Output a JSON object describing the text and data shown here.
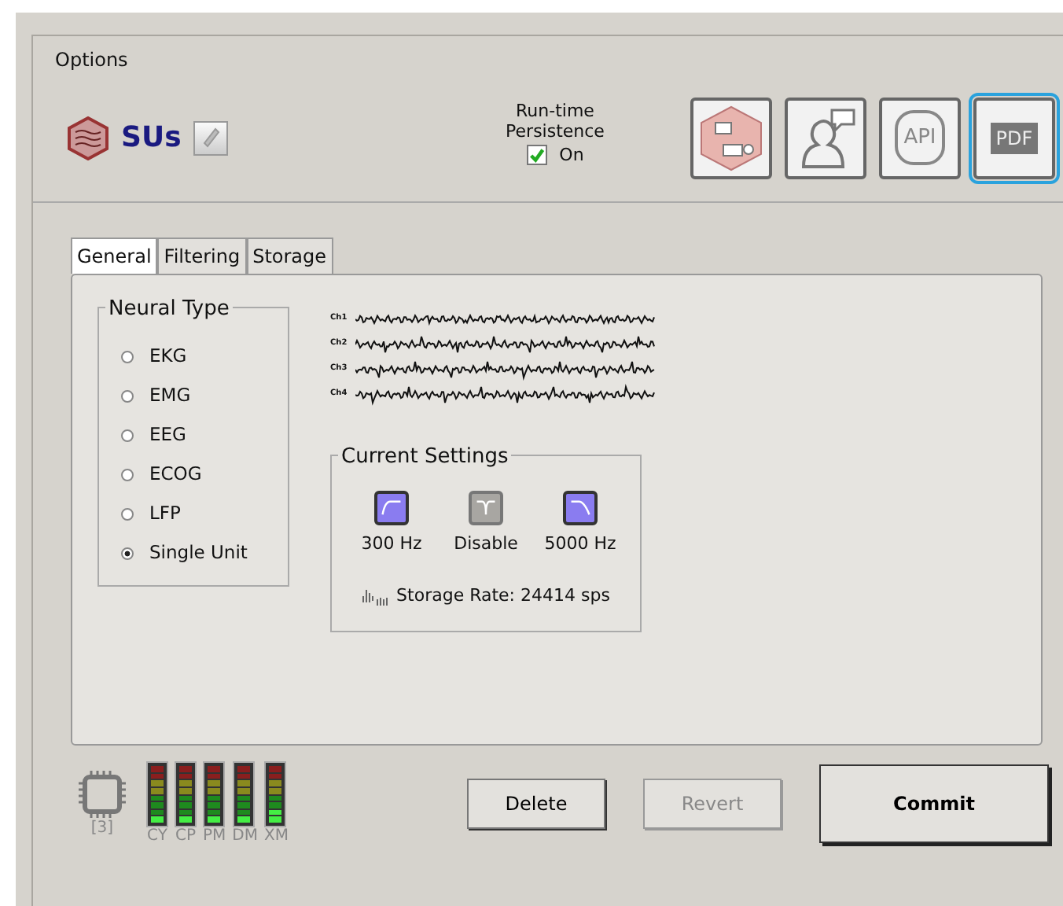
{
  "group_title": "Options",
  "header": {
    "name": "SUs",
    "persistence_label": "Run-time Persistence",
    "persistence": {
      "label": "On",
      "checked": true
    }
  },
  "tools": [
    {
      "kind": "diagram",
      "selected": false
    },
    {
      "kind": "user",
      "selected": false
    },
    {
      "kind": "api",
      "label": "API",
      "selected": false
    },
    {
      "kind": "pdf",
      "label": "PDF",
      "selected": true
    }
  ],
  "tabs": [
    {
      "label": "General",
      "selected": true
    },
    {
      "label": "Filtering",
      "selected": false
    },
    {
      "label": "Storage",
      "selected": false
    }
  ],
  "neural_type": {
    "title": "Neural Type",
    "options": [
      {
        "label": "EKG",
        "selected": false
      },
      {
        "label": "EMG",
        "selected": false
      },
      {
        "label": "EEG",
        "selected": false
      },
      {
        "label": "ECOG",
        "selected": false
      },
      {
        "label": "LFP",
        "selected": false
      },
      {
        "label": "Single Unit",
        "selected": true
      }
    ]
  },
  "channels": [
    {
      "label": "Ch1"
    },
    {
      "label": "Ch2"
    },
    {
      "label": "Ch3"
    },
    {
      "label": "Ch4"
    }
  ],
  "current_settings": {
    "title": "Current Settings",
    "filters": [
      {
        "kind": "highpass",
        "enabled": true,
        "label": "300 Hz"
      },
      {
        "kind": "notch",
        "enabled": false,
        "label": "Disable"
      },
      {
        "kind": "lowpass",
        "enabled": true,
        "label": "5000 Hz"
      }
    ],
    "storage_rate": "Storage Rate: 24414 sps"
  },
  "cpu": {
    "label": "[3]"
  },
  "meters": [
    {
      "label": "CY",
      "level": 0.1
    },
    {
      "label": "CP",
      "level": 0.1
    },
    {
      "label": "PM",
      "level": 0.1
    },
    {
      "label": "DM",
      "level": 0.1
    },
    {
      "label": "XM",
      "level": 0.3
    }
  ],
  "buttons": [
    {
      "label": "Delete",
      "disabled": false,
      "primary": false
    },
    {
      "label": "Revert",
      "disabled": true,
      "primary": false
    },
    {
      "label": "Commit",
      "disabled": false,
      "primary": true
    }
  ]
}
